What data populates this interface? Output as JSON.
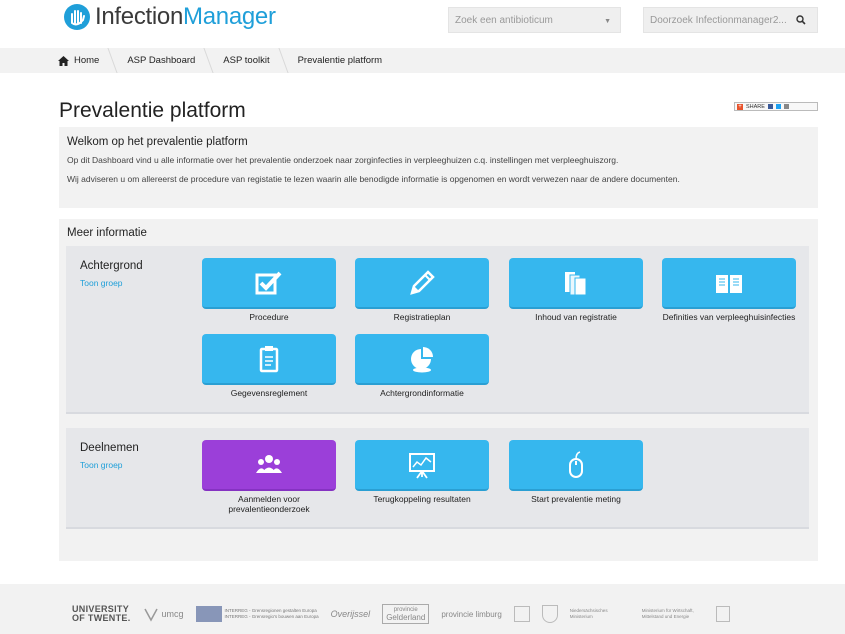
{
  "header": {
    "logo_part1": "Infection",
    "logo_part2": "Manager",
    "antibiotic_placeholder": "Zoek een antibioticum",
    "search_placeholder": "Doorzoek Infectionmanager2..."
  },
  "breadcrumb": [
    "Home",
    "ASP Dashboard",
    "ASP toolkit",
    "Prevalentie platform"
  ],
  "page_title": "Prevalentie platform",
  "share_label": "SHARE",
  "welcome": {
    "title": "Welkom op het prevalentie platform",
    "line1": "Op dit Dashboard vind u alle informatie over het prevalentie onderzoek naar zorginfecties in verpleeghuizen c.q. instellingen met verpleeghuiszorg.",
    "line2": "Wij adviseren u om allereerst de procedure van registatie te lezen waarin alle benodigde informatie is opgenomen en wordt verwezen naar de andere documenten."
  },
  "meer": {
    "title": "Meer informatie",
    "groups": [
      {
        "title": "Achtergrond",
        "toggle": "Toon groep",
        "tiles": [
          {
            "label": "Procedure",
            "icon": "checkbox-icon"
          },
          {
            "label": "Registratieplan",
            "icon": "pencil-icon"
          },
          {
            "label": "Inhoud van registratie",
            "icon": "documents-icon"
          },
          {
            "label": "Definities van verpleeghuisinfecties",
            "icon": "book-icon"
          },
          {
            "label": "Gegevensreglement",
            "icon": "clipboard-icon"
          },
          {
            "label": "Achtergrondinformatie",
            "icon": "pie-chart-icon"
          }
        ]
      },
      {
        "title": "Deelnemen",
        "toggle": "Toon groep",
        "tiles": [
          {
            "label": "Aanmelden voor prevalentieonderzoek",
            "icon": "users-icon"
          },
          {
            "label": "Terugkoppeling resultaten",
            "icon": "presentation-icon"
          },
          {
            "label": "Start prevalentie meting",
            "icon": "mouse-icon"
          }
        ]
      }
    ]
  },
  "footer": {
    "ut_line1": "UNIVERSITY",
    "ut_line2": "OF TWENTE.",
    "umcg": "umcg",
    "interreg1": "INTERREG - Grensregionen gestalten Europa",
    "interreg2": "INTERREG - Grensregio's bouwen aan Europa",
    "overijssel": "Overijssel",
    "gelderland1": "provincie",
    "gelderland2": "Gelderland",
    "limburg": "provincie limburg",
    "ministerie1": "Niedersächsisches Ministerium",
    "ministerie2": "Ministerium für Wirtschaft, Mittelstand und Energie"
  },
  "colors": {
    "tile_blue": "#36b7ee",
    "tile_purple": "#9b3fd9",
    "link_blue": "#1f9fd9",
    "panel_grey": "#f2f2f2"
  }
}
